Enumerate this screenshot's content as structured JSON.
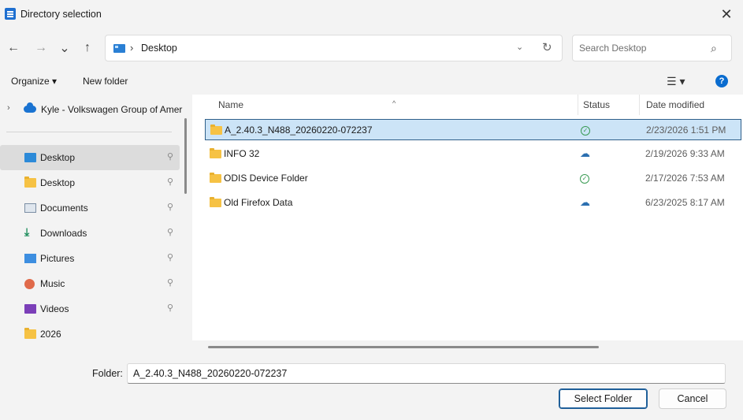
{
  "window": {
    "title": "Directory selection"
  },
  "nav": {
    "back": "←",
    "forward": "→",
    "recent": "⌄",
    "up": "↑",
    "breadcrumb_sep": "›",
    "location": "Desktop",
    "dropdown": "⌄",
    "refresh": "↻",
    "search_placeholder": "Search Desktop"
  },
  "toolbar": {
    "organize_label": "Organize ▾",
    "new_folder_label": "New folder",
    "view_label": "☰ ▾",
    "help_label": "?"
  },
  "tree": {
    "top": {
      "label": "Kyle - Volkswagen Group of Amer",
      "chevron": "›"
    },
    "items": [
      {
        "label": "Desktop",
        "icon": "desktop-icon",
        "pinned": true,
        "selected": true
      },
      {
        "label": "Desktop",
        "icon": "folder-icon",
        "pinned": true,
        "selected": false
      },
      {
        "label": "Documents",
        "icon": "documents-icon",
        "pinned": true,
        "selected": false
      },
      {
        "label": "Downloads",
        "icon": "downloads-icon",
        "pinned": true,
        "selected": false
      },
      {
        "label": "Pictures",
        "icon": "pictures-icon",
        "pinned": true,
        "selected": false
      },
      {
        "label": "Music",
        "icon": "music-icon",
        "pinned": true,
        "selected": false
      },
      {
        "label": "Videos",
        "icon": "videos-icon",
        "pinned": true,
        "selected": false
      },
      {
        "label": "2026",
        "icon": "folder-icon",
        "pinned": false,
        "selected": false
      }
    ],
    "pin_glyph": "📌"
  },
  "files": {
    "columns": [
      "Name",
      "Status",
      "Date modified"
    ],
    "sort_caret": "^",
    "rows": [
      {
        "name": "A_2.40.3_N488_20260220-072237",
        "status": "synced",
        "status_glyph": "⊘",
        "date": "2/23/2026 1:51 PM",
        "selected": true
      },
      {
        "name": "INFO 32",
        "status": "cloud",
        "status_glyph": "☁",
        "date": "2/19/2026 9:33 AM",
        "selected": false
      },
      {
        "name": "ODIS Device Folder",
        "status": "synced",
        "status_glyph": "⊘",
        "date": "2/17/2026 7:53 AM",
        "selected": false
      },
      {
        "name": "Old Firefox Data",
        "status": "cloud",
        "status_glyph": "☁",
        "date": "6/23/2025 8:17 AM",
        "selected": false
      }
    ]
  },
  "footer": {
    "folder_label": "Folder:",
    "folder_value": "A_2.40.3_N488_20260220-072237",
    "select_label": "Select Folder",
    "cancel_label": "Cancel"
  },
  "colors": {
    "accent": "#0a6ccf",
    "selection": "#cce4f7",
    "selection_border": "#2f5f8a",
    "synced": "#3a9b54",
    "cloud": "#2b6fb0"
  }
}
